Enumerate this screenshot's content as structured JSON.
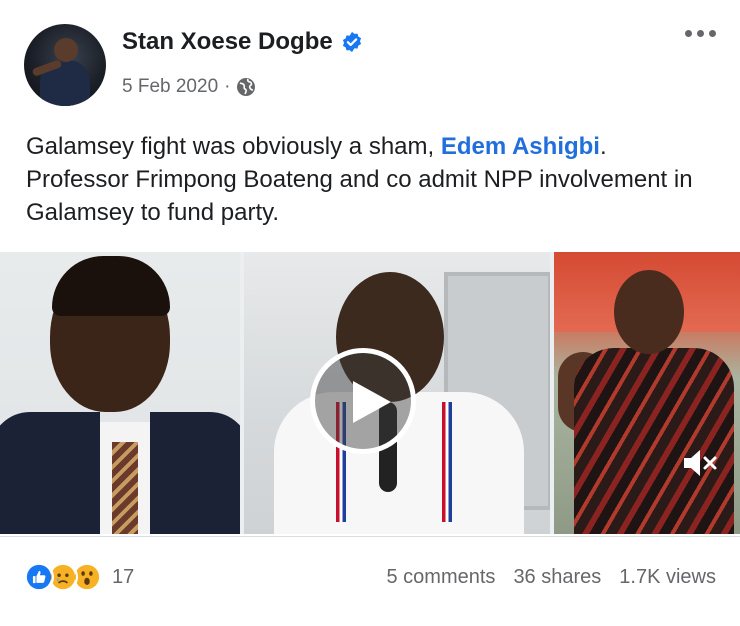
{
  "post": {
    "author": "Stan Xoese Dogbe",
    "date": "5 Feb 2020",
    "separator": "·",
    "text_before": "Galamsey fight was obviously a sham, ",
    "mention": "Edem Ashigbi",
    "text_after": ". Professor Frimpong Boateng and co admit NPP involvement in Galamsey to fund party."
  },
  "footer": {
    "reaction_count": "17",
    "comments": "5 comments",
    "shares": "36 shares",
    "views": "1.7K views"
  },
  "icons": {
    "verified": "verified-badge-icon",
    "privacy": "globe-icon",
    "more": "more-options-icon",
    "play": "play-icon",
    "mute": "mute-icon"
  },
  "colors": {
    "link": "#216fdb",
    "like": "#1877f2",
    "muted_text": "#65676b"
  }
}
